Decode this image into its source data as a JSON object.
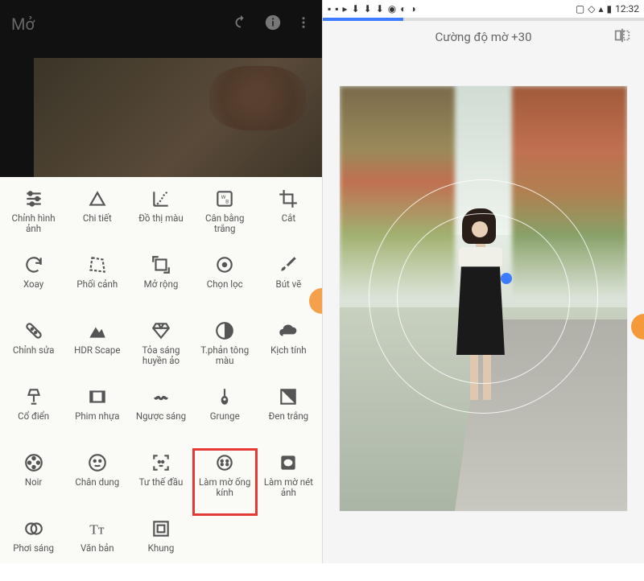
{
  "left": {
    "title": "Mở",
    "tools": [
      {
        "id": "tune",
        "label": "Chỉnh hình ảnh"
      },
      {
        "id": "details",
        "label": "Chi tiết"
      },
      {
        "id": "curves",
        "label": "Đồ thị màu"
      },
      {
        "id": "wb",
        "label": "Cân bằng trắng"
      },
      {
        "id": "crop",
        "label": "Cắt"
      },
      {
        "id": "rotate",
        "label": "Xoay"
      },
      {
        "id": "perspective",
        "label": "Phối cảnh"
      },
      {
        "id": "expand",
        "label": "Mở rộng"
      },
      {
        "id": "selective",
        "label": "Chọn lọc"
      },
      {
        "id": "brush",
        "label": "Bút vẽ"
      },
      {
        "id": "healing",
        "label": "Chỉnh sửa"
      },
      {
        "id": "hdr",
        "label": "HDR Scape"
      },
      {
        "id": "glamour",
        "label": "Tỏa sáng huyền ảo"
      },
      {
        "id": "tonal",
        "label": "T.phản tông màu"
      },
      {
        "id": "drama",
        "label": "Kịch tính"
      },
      {
        "id": "vintage",
        "label": "Cổ điển"
      },
      {
        "id": "grainy",
        "label": "Phim nhựa"
      },
      {
        "id": "retrolux",
        "label": "Ngược sáng"
      },
      {
        "id": "grunge",
        "label": "Grunge"
      },
      {
        "id": "bw",
        "label": "Đen trắng"
      },
      {
        "id": "noir",
        "label": "Noir"
      },
      {
        "id": "portrait",
        "label": "Chân dung"
      },
      {
        "id": "headpose",
        "label": "Tư thế đầu"
      },
      {
        "id": "lensblur",
        "label": "Làm mờ ống kính",
        "highlight": true
      },
      {
        "id": "vignette",
        "label": "Làm mờ nét ảnh"
      },
      {
        "id": "doubleexp",
        "label": "Phơi sáng"
      },
      {
        "id": "text",
        "label": "Văn bản"
      },
      {
        "id": "frame",
        "label": "Khung"
      }
    ]
  },
  "right": {
    "status_time": "12:32",
    "header_text": "Cường độ mờ +30"
  }
}
